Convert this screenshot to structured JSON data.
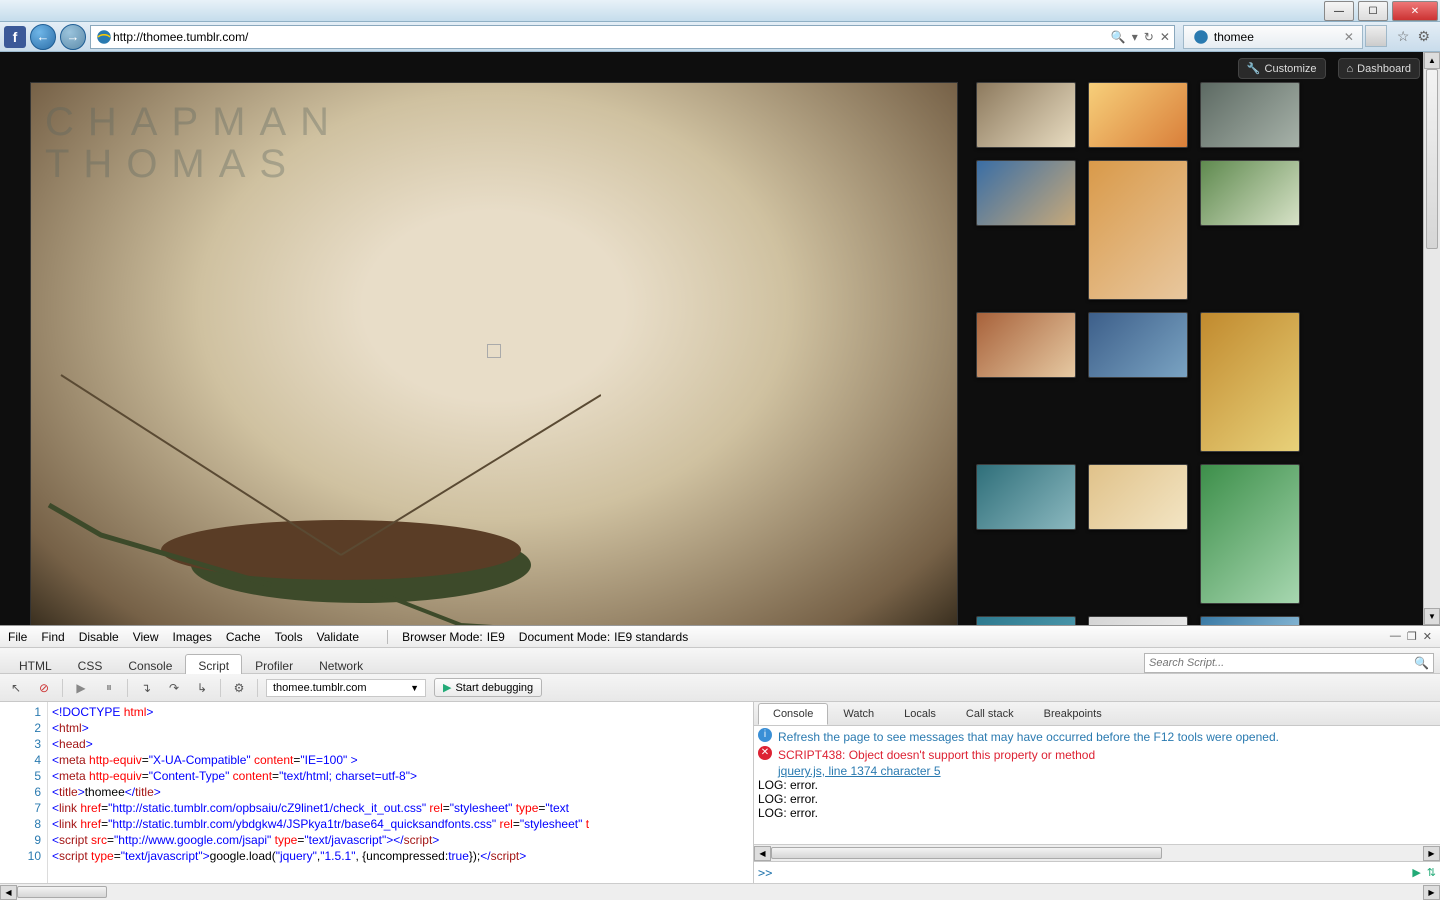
{
  "window": {
    "title": ""
  },
  "nav": {
    "url": "http://thomee.tumblr.com/",
    "tab_title": "thomee"
  },
  "tumblr": {
    "customize": "Customize",
    "dashboard": "Dashboard",
    "watermark_line1": "CHAPMAN",
    "watermark_line2": "THOMAS"
  },
  "thumbs": [
    {
      "c1": "#8d7a5e",
      "c2": "#e8dcc1",
      "tall": false
    },
    {
      "c1": "#f7cf7a",
      "c2": "#d97f3a",
      "tall": false
    },
    {
      "c1": "#5d6a63",
      "c2": "#a7b2a9",
      "tall": false
    },
    {
      "c1": "#3a6ea5",
      "c2": "#c7a97a",
      "tall": false
    },
    {
      "c1": "#d99a4a",
      "c2": "#e8c79e",
      "tall": true
    },
    {
      "c1": "#5f8a4f",
      "c2": "#d7e2c7",
      "tall": false
    },
    {
      "c1": "#a8623b",
      "c2": "#e6c9a2",
      "tall": false
    },
    {
      "c1": "#3d5f8a",
      "c2": "#7aa3c2",
      "tall": false
    },
    {
      "c1": "#c18a2e",
      "c2": "#e8d17a",
      "tall": true
    },
    {
      "c1": "#2f6f7a",
      "c2": "#8bb8bf",
      "tall": false
    },
    {
      "c1": "#e0c28a",
      "c2": "#f3e5c4",
      "tall": false
    },
    {
      "c1": "#3d8f4a",
      "c2": "#a7d7b0",
      "tall": true
    },
    {
      "c1": "#2e7a8f",
      "c2": "#68b4c7",
      "tall": true
    },
    {
      "c1": "#d5d5d5",
      "c2": "#f2f2f2",
      "tall": false
    },
    {
      "c1": "#3a7aa5",
      "c2": "#a6d0e8",
      "tall": false
    },
    {
      "c1": "#d94a6a",
      "c2": "#2a9f7a",
      "tall": false
    }
  ],
  "devtools": {
    "menu": [
      "File",
      "Find",
      "Disable",
      "View",
      "Images",
      "Cache",
      "Tools",
      "Validate"
    ],
    "browser_mode_label": "Browser Mode:",
    "browser_mode_value": "IE9",
    "doc_mode_label": "Document Mode:",
    "doc_mode_value": "IE9 standards",
    "tabs": [
      "HTML",
      "CSS",
      "Console",
      "Script",
      "Profiler",
      "Network"
    ],
    "active_tab": "Script",
    "search_placeholder": "Search Script...",
    "file_dropdown": "thomee.tumblr.com",
    "start_debugging": "Start debugging",
    "console_tabs": [
      "Console",
      "Watch",
      "Locals",
      "Call stack",
      "Breakpoints"
    ],
    "console_active": "Console",
    "info_msg": "Refresh the page to see messages that may have occurred before the F12 tools were opened.",
    "error_msg": "SCRIPT438: Object doesn't support this property or method",
    "error_link": "jquery.js, line 1374 character 5",
    "log1": "LOG: error.",
    "log2": "LOG: error.",
    "log3": "LOG: error.",
    "prompt": ">>",
    "code": [
      {
        "n": 1,
        "html": "<span class='t-kw'>&lt;!DOCTYPE</span> <span class='t-attr'>html</span><span class='t-kw'>&gt;</span>"
      },
      {
        "n": 2,
        "html": "<span class='t-kw'>&lt;</span><span class='t-tag'>html</span><span class='t-kw'>&gt;</span>"
      },
      {
        "n": 3,
        "html": "<span class='t-kw'>&lt;</span><span class='t-tag'>head</span><span class='t-kw'>&gt;</span>"
      },
      {
        "n": 4,
        "html": "<span class='t-kw'>&lt;</span><span class='t-tag'>meta</span> <span class='t-attr'>http-equiv</span>=<span class='t-str'>\"X-UA-Compatible\"</span> <span class='t-attr'>content</span>=<span class='t-str'>\"IE=100\"</span> <span class='t-kw'>&gt;</span>"
      },
      {
        "n": 5,
        "html": "<span class='t-kw'>&lt;</span><span class='t-tag'>meta</span> <span class='t-attr'>http-equiv</span>=<span class='t-str'>\"Content-Type\"</span> <span class='t-attr'>content</span>=<span class='t-str'>\"text/html; charset=utf-8\"</span><span class='t-kw'>&gt;</span>"
      },
      {
        "n": 6,
        "html": "<span class='t-kw'>&lt;</span><span class='t-tag'>title</span><span class='t-kw'>&gt;</span>thomee<span class='t-kw'>&lt;/</span><span class='t-tag'>title</span><span class='t-kw'>&gt;</span>"
      },
      {
        "n": 7,
        "html": "<span class='t-kw'>&lt;</span><span class='t-tag'>link</span> <span class='t-attr'>href</span>=<span class='t-str'>\"http://static.tumblr.com/opbsaiu/cZ9linet1/check_it_out.css\"</span> <span class='t-attr'>rel</span>=<span class='t-str'>\"stylesheet\"</span> <span class='t-attr'>type</span>=<span class='t-str'>\"text</span>"
      },
      {
        "n": 8,
        "html": "<span class='t-kw'>&lt;</span><span class='t-tag'>link</span> <span class='t-attr'>href</span>=<span class='t-str'>\"http://static.tumblr.com/ybdgkw4/JSPkya1tr/base64_quicksandfonts.css\"</span> <span class='t-attr'>rel</span>=<span class='t-str'>\"stylesheet\"</span> <span class='t-attr'>t</span>"
      },
      {
        "n": 9,
        "html": "<span class='t-kw'>&lt;</span><span class='t-tag'>script</span> <span class='t-attr'>src</span>=<span class='t-str'>\"http://www.google.com/jsapi\"</span> <span class='t-attr'>type</span>=<span class='t-str'>\"text/javascript\"</span><span class='t-kw'>&gt;&lt;/</span><span class='t-tag'>script</span><span class='t-kw'>&gt;</span>"
      },
      {
        "n": 10,
        "html": "<span class='t-kw'>&lt;</span><span class='t-tag'>script</span> <span class='t-attr'>type</span>=<span class='t-str'>\"text/javascript\"</span><span class='t-kw'>&gt;</span>google.load(<span class='t-str'>\"jquery\"</span>,<span class='t-str'>\"1.5.1\"</span>, {uncompressed:<span class='t-kw'>true</span>});<span class='t-kw'>&lt;/</span><span class='t-tag'>script</span><span class='t-kw'>&gt;</span>"
      }
    ]
  }
}
